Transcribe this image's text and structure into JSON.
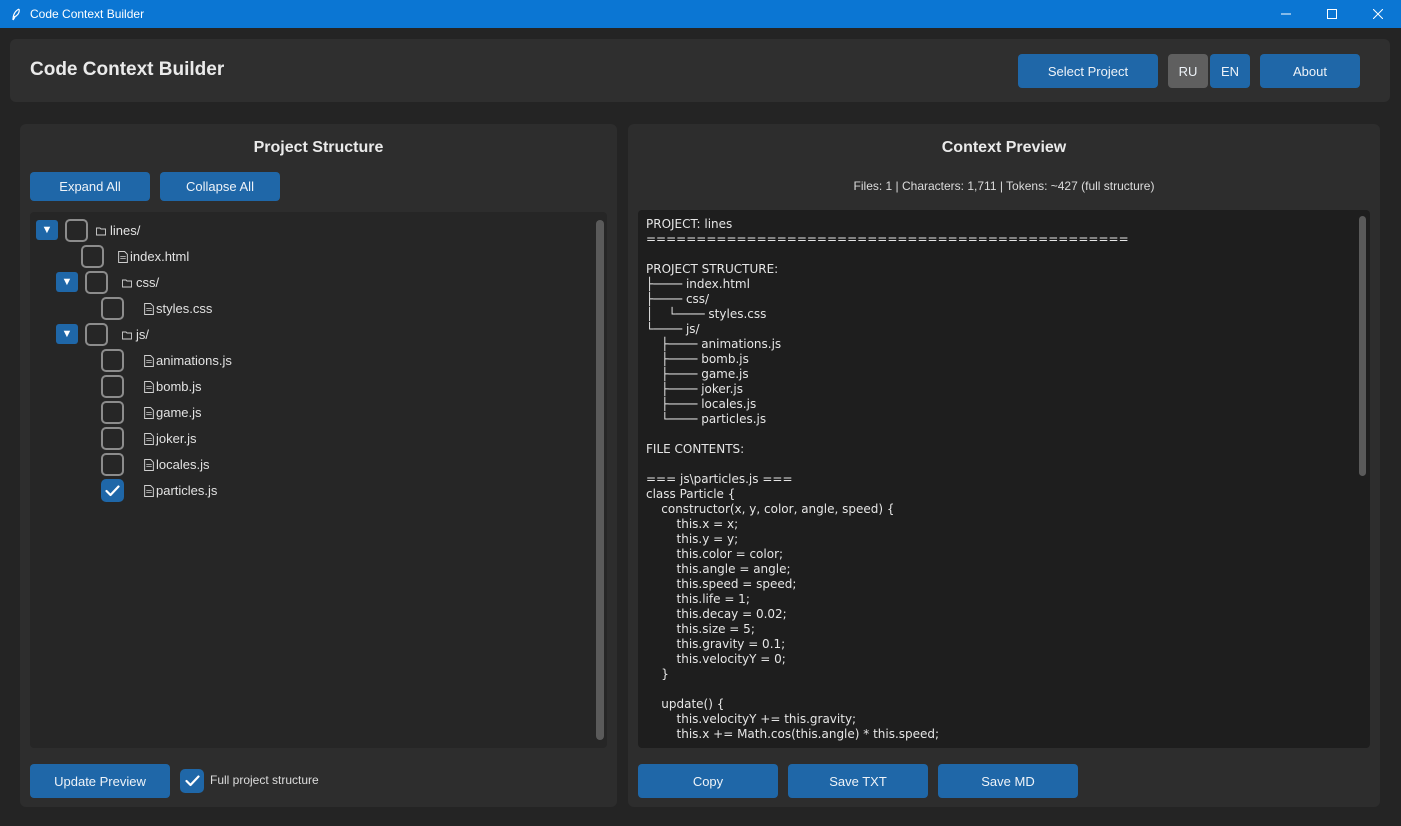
{
  "window": {
    "title": "Code Context Builder"
  },
  "header": {
    "app_title": "Code Context Builder",
    "select_project": "Select Project",
    "lang_ru": "RU",
    "lang_en": "EN",
    "about": "About"
  },
  "left_panel": {
    "title": "Project Structure",
    "expand_all": "Expand All",
    "collapse_all": "Collapse All",
    "tree": [
      {
        "label": "lines/",
        "type": "folder",
        "expanded": true,
        "checked": false
      },
      {
        "label": "index.html",
        "type": "file",
        "checked": false
      },
      {
        "label": "css/",
        "type": "folder",
        "expanded": true,
        "checked": false
      },
      {
        "label": "styles.css",
        "type": "file",
        "checked": false
      },
      {
        "label": "js/",
        "type": "folder",
        "expanded": true,
        "checked": false
      },
      {
        "label": "animations.js",
        "type": "file",
        "checked": false
      },
      {
        "label": "bomb.js",
        "type": "file",
        "checked": false
      },
      {
        "label": "game.js",
        "type": "file",
        "checked": false
      },
      {
        "label": "joker.js",
        "type": "file",
        "checked": false
      },
      {
        "label": "locales.js",
        "type": "file",
        "checked": false
      },
      {
        "label": "particles.js",
        "type": "file",
        "checked": true
      }
    ],
    "update_preview": "Update Preview",
    "full_structure_label": "Full project structure",
    "full_structure_checked": true
  },
  "right_panel": {
    "title": "Context Preview",
    "stats": "Files: 1 | Characters: 1,711 | Tokens: ~427 (full structure)",
    "preview_text": "PROJECT: lines\n================================================\n\nPROJECT STRUCTURE:\n├──── index.html\n├──── css/\n│    └──── styles.css\n└──── js/\n    ├──── animations.js\n    ├──── bomb.js\n    ├──── game.js\n    ├──── joker.js\n    ├──── locales.js\n    └──── particles.js\n\nFILE CONTENTS:\n\n=== js\\particles.js ===\nclass Particle {\n    constructor(x, y, color, angle, speed) {\n        this.x = x;\n        this.y = y;\n        this.color = color;\n        this.angle = angle;\n        this.speed = speed;\n        this.life = 1;\n        this.decay = 0.02;\n        this.size = 5;\n        this.gravity = 0.1;\n        this.velocityY = 0;\n    }\n\n    update() {\n        this.velocityY += this.gravity;\n        this.x += Math.cos(this.angle) * this.speed;",
    "copy": "Copy",
    "save_txt": "Save TXT",
    "save_md": "Save MD"
  },
  "colors": {
    "accent": "#1f67a8",
    "titlebar": "#0b76d3",
    "background": "#242424",
    "panel": "#2d2d2d"
  }
}
